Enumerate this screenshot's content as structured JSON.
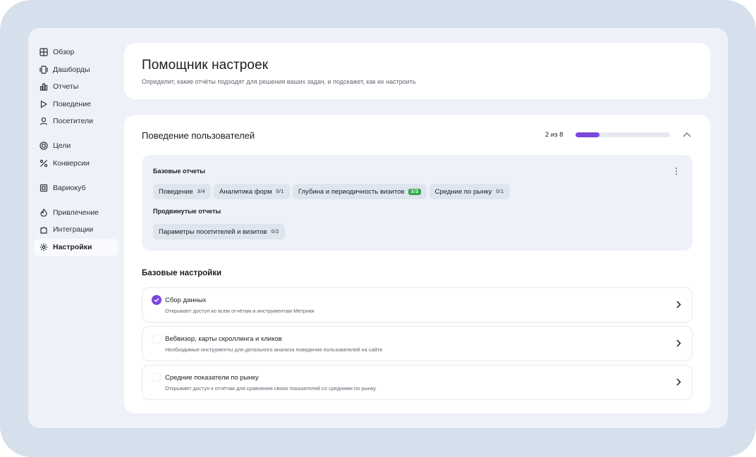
{
  "sidebar": {
    "items": [
      {
        "label": "Обзор",
        "icon": "grid-icon"
      },
      {
        "label": "Дашборды",
        "icon": "dashboards-icon"
      },
      {
        "label": "Отчеты",
        "icon": "bar-chart-icon"
      },
      {
        "label": "Поведение",
        "icon": "play-icon"
      },
      {
        "label": "Посетители",
        "icon": "user-icon"
      },
      {
        "label": "Цели",
        "icon": "target-icon"
      },
      {
        "label": "Конверсии",
        "icon": "percent-icon"
      },
      {
        "label": "Вариокуб",
        "icon": "cube-icon"
      },
      {
        "label": "Привлечение",
        "icon": "flame-icon"
      },
      {
        "label": "Интеграции",
        "icon": "puzzle-icon"
      },
      {
        "label": "Настройки",
        "icon": "gear-icon"
      }
    ],
    "active": "Настройки"
  },
  "header": {
    "title": "Помощник настроек",
    "subtitle": "Определит, какие отчёты подходят для решения ваших задач, и подскажет, как их настроить"
  },
  "section": {
    "title": "Поведение пользователей",
    "progress_text": "2 из 8",
    "progress_fraction": 0.25,
    "accent_color": "#7a46e0"
  },
  "reports": {
    "basic_label": "Базовые отчеты",
    "basic": [
      {
        "label": "Поведение",
        "count": "3/4",
        "done": false
      },
      {
        "label": "Аналитика форм",
        "count": "0/1",
        "done": false
      },
      {
        "label": "Глубина и периодичность визитов",
        "count": "3/3",
        "done": true
      },
      {
        "label": "Средние по рынку",
        "count": "0/1",
        "done": false
      }
    ],
    "advanced_label": "Продвинутые отчеты",
    "advanced": [
      {
        "label": "Параметры посетителей и визитов",
        "count": "0/2",
        "done": false
      }
    ]
  },
  "settings": {
    "title": "Базовые настройки",
    "items": [
      {
        "name": "Сбор данных",
        "desc": "Открывает доступ ко всем отчётам и инструментам Метрики",
        "checked": true
      },
      {
        "name": "Вебвизор, карты скроллинга и кликов",
        "desc": "Необходимые инструменты для детального анализа поведения пользователей на сайте",
        "checked": false
      },
      {
        "name": "Средние показатели по рынку",
        "desc": "Открывает доступ к отчётам для сравнения своих показателей со средними по рынку",
        "checked": false
      }
    ]
  }
}
